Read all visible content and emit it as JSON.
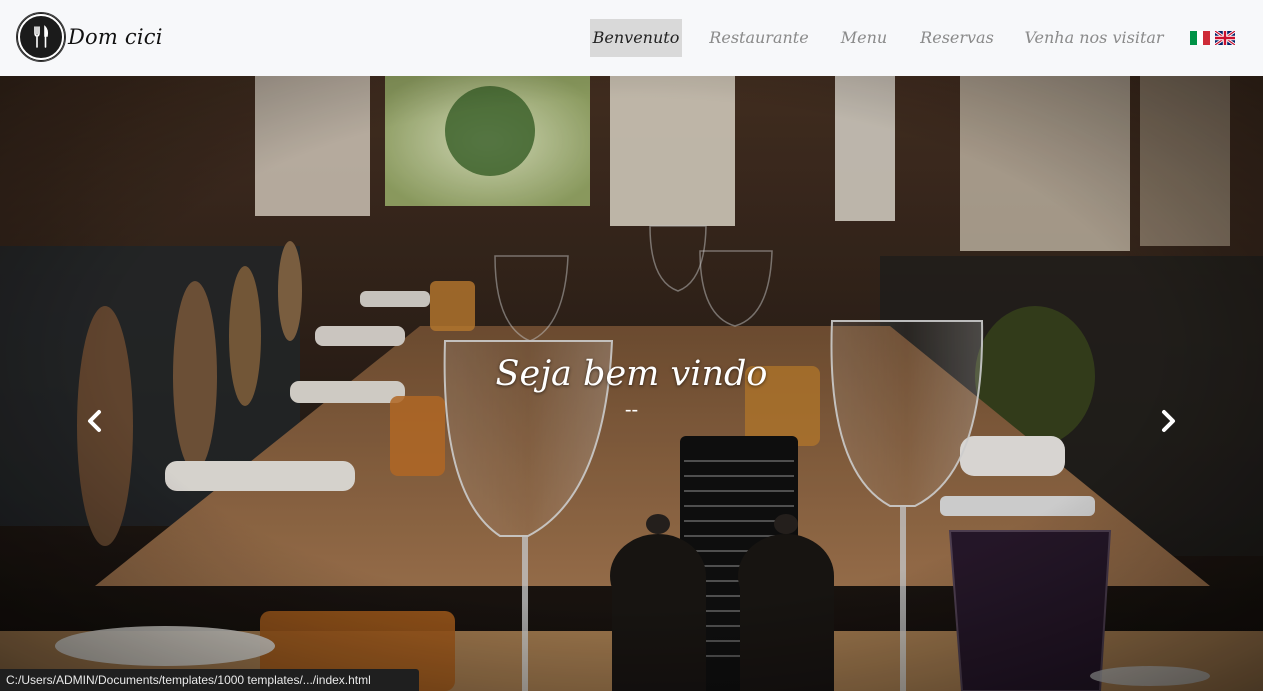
{
  "brand": {
    "name": "Dom cici"
  },
  "nav": {
    "items": [
      {
        "label": "Benvenuto",
        "active": true
      },
      {
        "label": "Restaurante",
        "active": false
      },
      {
        "label": "Menu",
        "active": false
      },
      {
        "label": "Reservas",
        "active": false
      },
      {
        "label": "Venha nos visitar",
        "active": false
      }
    ],
    "languages": [
      "italian-flag-icon",
      "uk-flag-icon"
    ]
  },
  "hero": {
    "title": "Seja bem vindo",
    "subtitle": "--"
  },
  "statusbar": {
    "url": "C:/Users/ADMIN/Documents/templates/1000 templates/.../index.html"
  },
  "colors": {
    "navbar_bg": "#f7f8fa",
    "active_tab_bg": "#d9d9d9",
    "nav_text": "#8a8a8a"
  }
}
